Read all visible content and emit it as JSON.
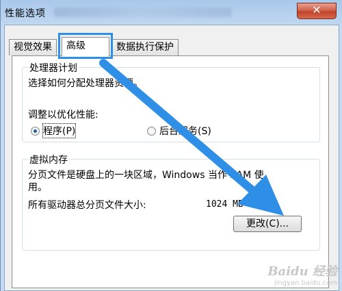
{
  "window": {
    "title": "性能选项",
    "close_symbol": "✕"
  },
  "tabs": [
    {
      "label": "视觉效果"
    },
    {
      "label": "高级"
    },
    {
      "label": "数据执行保护"
    }
  ],
  "processor": {
    "title": "处理器计划",
    "description": "选择如何分配处理器资源。",
    "adjust_label": "调整以优化性能:",
    "options": [
      {
        "label": "程序(P)",
        "checked": true
      },
      {
        "label": "后台服务(S)",
        "checked": false
      }
    ]
  },
  "virtual_memory": {
    "title": "虚拟内存",
    "description_line1": "分页文件是硬盘上的一块区域，Windows 当作 RAM 使",
    "description_line2": "用。",
    "total_label": "所有驱动器总分页文件大小:",
    "total_value": "1024 MB",
    "change_button": "更改(C)..."
  },
  "annotation": {
    "color": "#2f8fe6"
  },
  "watermark": {
    "main": "Baidu 经验",
    "sub": "jingyan.baidu.com"
  }
}
